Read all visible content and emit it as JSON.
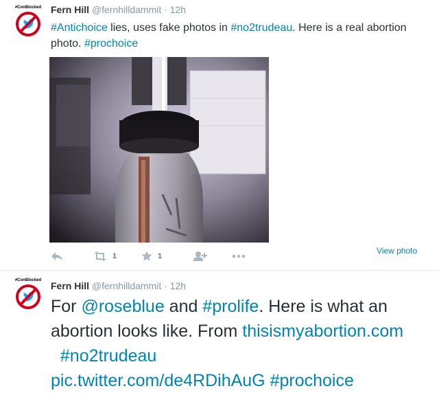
{
  "tweets": [
    {
      "avatar_label": "#ConBlocked",
      "name": "Fern Hill",
      "handle": "@fernhilldammit",
      "separator": "·",
      "time": "12h",
      "text": {
        "hashtag1": "#Antichoice",
        "part1": " lies, uses fake photos in ",
        "hashtag2": "#no2trudeau",
        "part2": ". Here is a real abortion photo. ",
        "hashtag3": "#prochoice"
      },
      "view_photo_label": "View photo",
      "retweet_count": "1",
      "favorite_count": "1"
    },
    {
      "avatar_label": "#ConBlocked",
      "name": "Fern Hill",
      "handle": "@fernhilldammit",
      "separator": "·",
      "time": "12h",
      "text": {
        "part1": "For ",
        "mention": "@roseblue",
        "part2": " and ",
        "hashtag1": "#prolife",
        "part3": ". Here is what an abortion looks like. From ",
        "link1": "thisismyabortion.com",
        "part4": "  ",
        "hashtag2": "#no2trudeau",
        "part5": " ",
        "link2": "pic.twitter.com/de4RDihAuG",
        "part6": " ",
        "hashtag3": "#prochoice"
      }
    }
  ],
  "icons": [
    "reply-icon",
    "retweet-icon",
    "favorite-icon",
    "follow-icon",
    "more-icon",
    "twitter-bird-icon"
  ],
  "colors": {
    "link": "#0084b4",
    "muted": "#8899a6",
    "no_sign": "#d0021b",
    "bird": "#1da1f2"
  }
}
